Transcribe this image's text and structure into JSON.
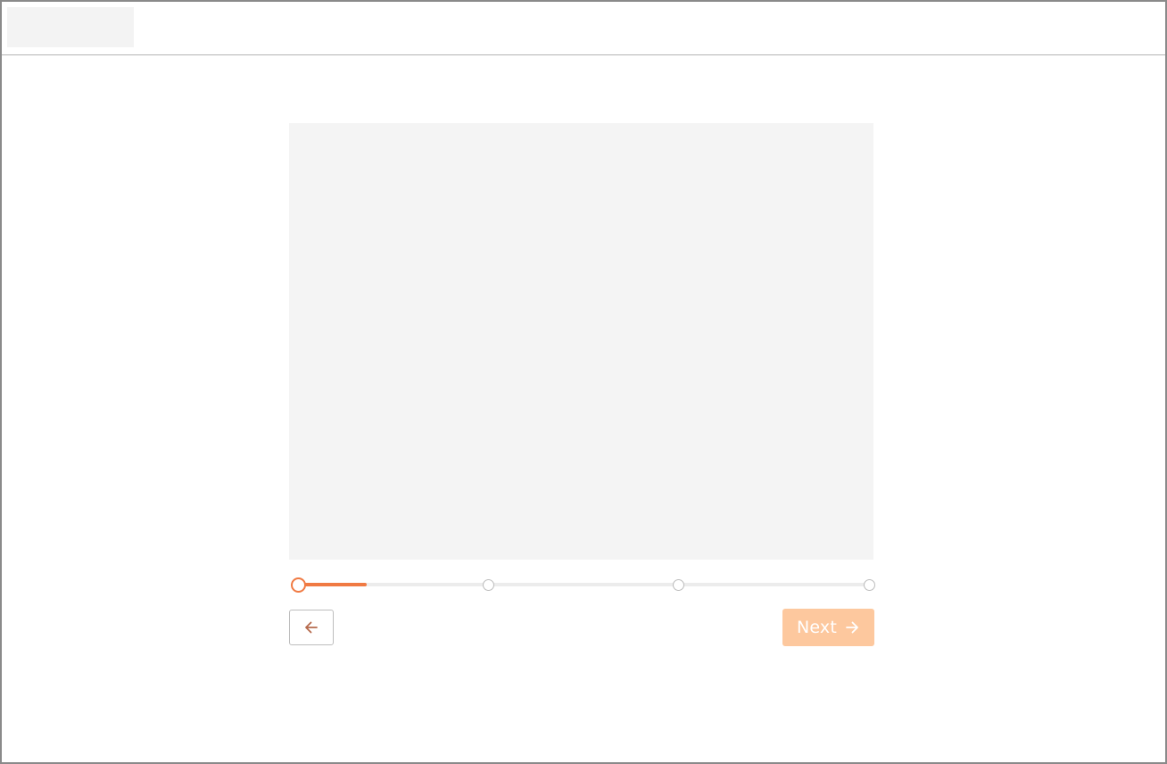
{
  "colors": {
    "accent": "#f07a43",
    "next_button_bg": "#fdc89e",
    "placeholder_bg": "#f4f4f4",
    "track": "#ececec",
    "border": "#8a8a8a"
  },
  "header": {
    "logo": ""
  },
  "stepper": {
    "total_steps": 4,
    "current_step": 1,
    "progress_fraction": 0.12
  },
  "navigation": {
    "back_icon": "arrow-left-icon",
    "next_label": "Next",
    "next_icon": "arrow-right-icon",
    "next_enabled": false
  }
}
